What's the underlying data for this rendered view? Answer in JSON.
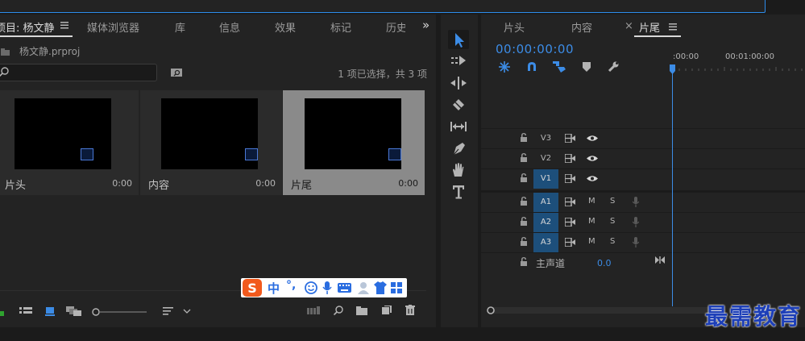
{
  "project_panel": {
    "tabs": [
      {
        "label": "项目: 杨文静",
        "active": true
      },
      {
        "label": "媒体浏览器"
      },
      {
        "label": "库"
      },
      {
        "label": "信息"
      },
      {
        "label": "效果"
      },
      {
        "label": "标记"
      },
      {
        "label": "历史"
      }
    ],
    "menu_icon": "hamburger-icon",
    "overflow": "»",
    "file_name": "杨文静.prproj",
    "search_placeholder": "",
    "selection_status": "1 项已选择，共 3 项",
    "clips": [
      {
        "name": "片头",
        "duration": "0:00",
        "selected": false
      },
      {
        "name": "内容",
        "duration": "0:00",
        "selected": false
      },
      {
        "name": "片尾",
        "duration": "0:00",
        "selected": true
      }
    ]
  },
  "ime": {
    "items": [
      "中",
      "°,"
    ]
  },
  "tools": [
    {
      "name": "selection-tool",
      "active": true
    },
    {
      "name": "track-select-tool"
    },
    {
      "name": "ripple-edit-tool"
    },
    {
      "name": "razor-tool"
    },
    {
      "name": "slip-tool"
    },
    {
      "name": "pen-tool"
    },
    {
      "name": "hand-tool"
    },
    {
      "name": "type-tool"
    }
  ],
  "timeline": {
    "tabs": [
      {
        "label": "片头"
      },
      {
        "label": "内容"
      },
      {
        "label": "片尾",
        "active": true,
        "close": "×"
      }
    ],
    "timecode": "00:00:00:00",
    "ruler_labels": [
      ":00:00",
      "00:01:00:00"
    ],
    "video_tracks": [
      {
        "label": "V3",
        "targeted": false
      },
      {
        "label": "V2",
        "targeted": false
      },
      {
        "label": "V1",
        "targeted": true
      }
    ],
    "audio_tracks": [
      {
        "label": "A1",
        "m": "M",
        "s": "S"
      },
      {
        "label": "A2",
        "m": "M",
        "s": "S"
      },
      {
        "label": "A3",
        "m": "M",
        "s": "S"
      }
    ],
    "master": {
      "label": "主声道",
      "value": "0.0"
    }
  },
  "watermark": "最需教育",
  "colors": {
    "accent": "#3c8ce6",
    "panel": "#232323",
    "selected_clip": "#8a8a8a"
  }
}
